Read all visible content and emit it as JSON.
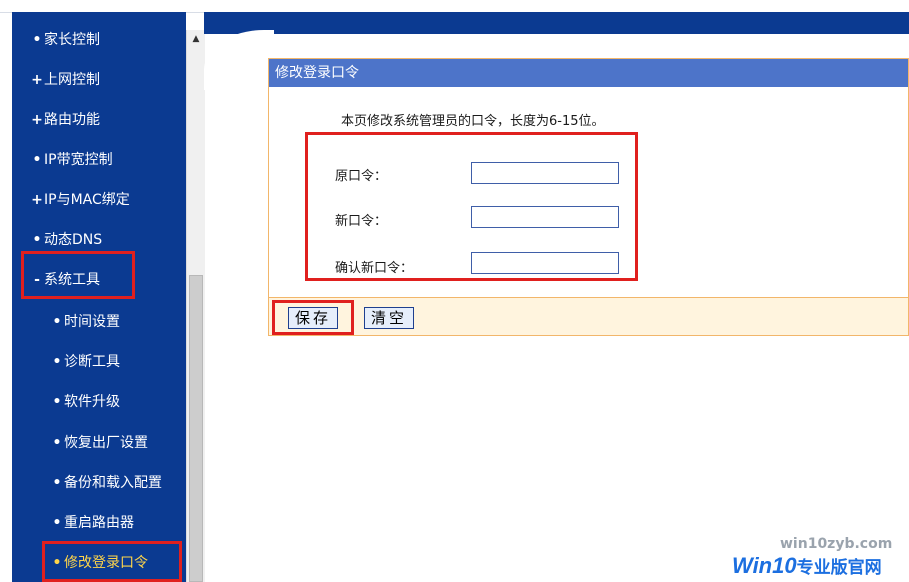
{
  "sidebar": {
    "items": [
      {
        "label": "家长控制",
        "bullet": "•"
      },
      {
        "label": "上网控制",
        "bullet": "+"
      },
      {
        "label": "路由功能",
        "bullet": "+"
      },
      {
        "label": "IP带宽控制",
        "bullet": "•"
      },
      {
        "label": "IP与MAC绑定",
        "bullet": "+"
      },
      {
        "label": "动态DNS",
        "bullet": "•"
      },
      {
        "label": "系统工具",
        "bullet": "-"
      },
      {
        "label": "时间设置",
        "bullet": "•"
      },
      {
        "label": "诊断工具",
        "bullet": "•"
      },
      {
        "label": "软件升级",
        "bullet": "•"
      },
      {
        "label": "恢复出厂设置",
        "bullet": "•"
      },
      {
        "label": "备份和载入配置",
        "bullet": "•"
      },
      {
        "label": "重启路由器",
        "bullet": "•"
      },
      {
        "label": "修改登录口令",
        "bullet": "•"
      }
    ]
  },
  "panel": {
    "title": "修改登录口令",
    "description": "本页修改系统管理员的口令，长度为6-15位。",
    "fields": [
      {
        "label": "原口令：",
        "value": ""
      },
      {
        "label": "新口令：",
        "value": ""
      },
      {
        "label": "确认新口令：",
        "value": ""
      }
    ],
    "buttons": {
      "save": "保存",
      "clear": "清空"
    }
  },
  "watermark": {
    "url": "win10zyb.com",
    "brand": "Win10",
    "brand_cn": "专业版官网"
  },
  "colors": {
    "sidebar_bg": "#0b3a91",
    "panel_title_bg": "#4d74c9",
    "highlight": "#e0201e",
    "active_text": "#ffd54a"
  }
}
